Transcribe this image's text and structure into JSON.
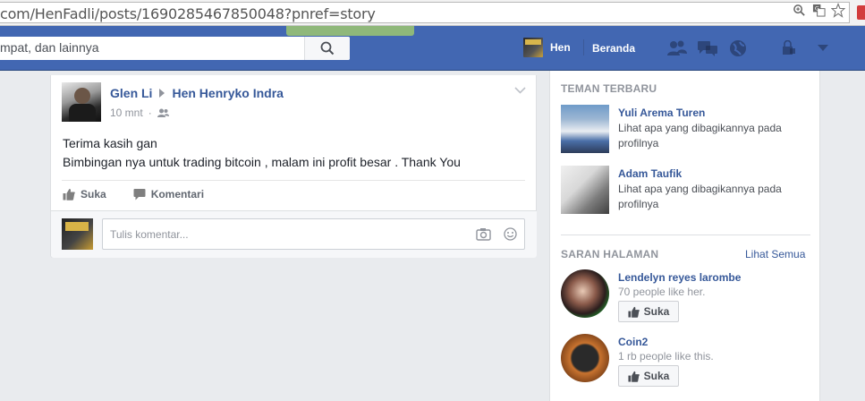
{
  "browser": {
    "url": "com/HenFadli/posts/1690285467850048?pnref=story"
  },
  "header": {
    "search_text": "mpat, dan lainnya",
    "user_name": "Hen",
    "home_label": "Beranda"
  },
  "post": {
    "author": "Glen Li",
    "target": "Hen Henryko Indra",
    "time": "10 mnt",
    "body_lines": [
      "Terima kasih gan",
      "Bimbingan nya untuk trading bitcoin , malam ini profit besar . Thank You"
    ],
    "like_label": "Suka",
    "comment_label": "Komentari",
    "comment_placeholder": "Tulis komentar..."
  },
  "sidebar": {
    "new_friends_title": "TEMAN TERBARU",
    "friends": [
      {
        "name": "Yuli Arema Turen",
        "subtitle": "Lihat apa yang dibagikannya pada profilnya"
      },
      {
        "name": "Adam Taufik",
        "subtitle": "Lihat apa yang dibagikannya pada profilnya"
      }
    ],
    "pages_title": "SARAN HALAMAN",
    "see_all": "Lihat Semua",
    "pages": [
      {
        "name": "Lendelyn reyes larombe",
        "likes": "70 people like her.",
        "like_label": "Suka"
      },
      {
        "name": "Coin2",
        "likes": "1 rb people like this.",
        "like_label": "Suka"
      }
    ]
  },
  "colors": {
    "brand_blue": "#4267b2",
    "link_blue": "#365899",
    "muted": "#90949c"
  }
}
